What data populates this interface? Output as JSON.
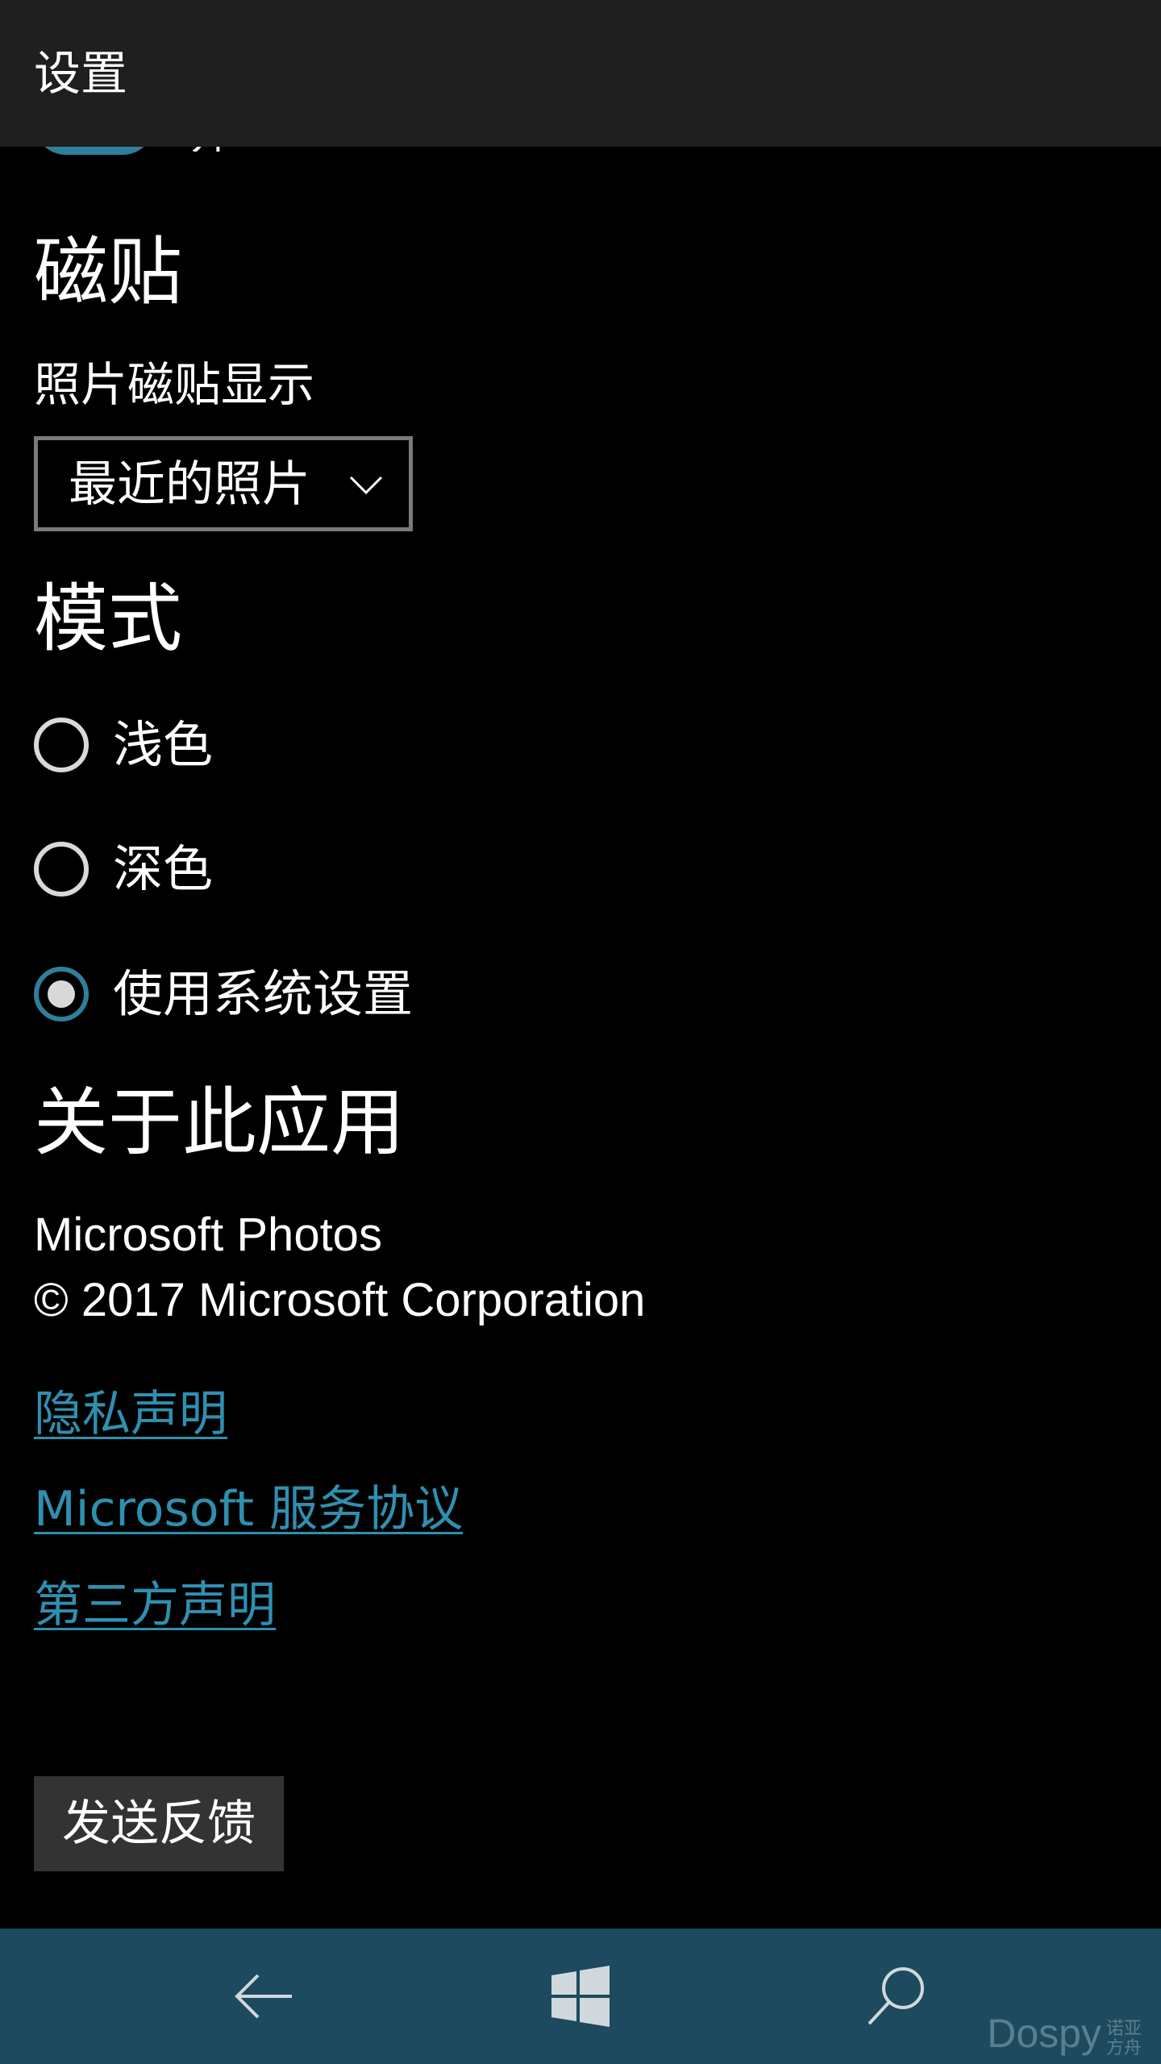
{
  "titlebar": {
    "title": "设置"
  },
  "partial_toggle": {
    "label": "开"
  },
  "tiles": {
    "heading": "磁贴",
    "photo_tile_label": "照片磁贴显示",
    "photo_tile_selected": "最近的照片"
  },
  "mode": {
    "heading": "模式",
    "options": [
      {
        "label": "浅色",
        "checked": false
      },
      {
        "label": "深色",
        "checked": false
      },
      {
        "label": "使用系统设置",
        "checked": true
      }
    ]
  },
  "about": {
    "heading": "关于此应用",
    "app_name": "Microsoft Photos",
    "copyright": "© 2017 Microsoft Corporation",
    "links": [
      "隐私声明",
      "Microsoft 服务协议",
      "第三方声明"
    ]
  },
  "feedback": {
    "label": "发送反馈"
  },
  "navbar": {
    "icons": [
      "back-arrow-icon",
      "windows-logo-icon",
      "search-icon"
    ],
    "watermark": "Dospy",
    "watermark_small_1": "诺亚",
    "watermark_small_2": "方舟"
  },
  "colors": {
    "accent": "#2f7f9b",
    "link": "#2f8fb0",
    "titlebar_bg": "#1f1f1f",
    "navbar_bg": "#1d4a5e",
    "button_bg": "#333333"
  }
}
